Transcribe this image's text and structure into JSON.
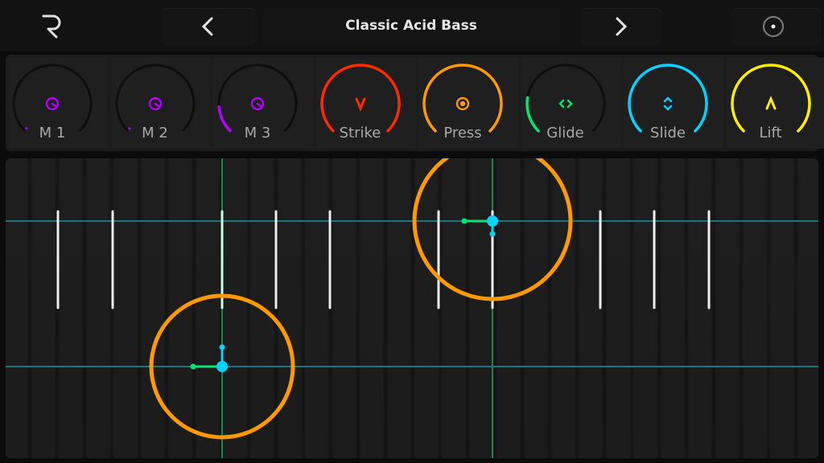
{
  "header": {
    "logo": "R",
    "preset_name": "Classic Acid Bass",
    "prev_icon": "chevron-left-icon",
    "next_icon": "chevron-right-icon",
    "menu_icon": "circle-dot-icon"
  },
  "knobs": [
    {
      "label": "M 1",
      "value": 0,
      "color": "#b400ff",
      "icon": "macro-knob-icon"
    },
    {
      "label": "M 2",
      "value": 0,
      "color": "#b400ff",
      "icon": "macro-knob-icon"
    },
    {
      "label": "M 3",
      "value": 0.15,
      "color": "#b400ff",
      "icon": "macro-knob-icon"
    },
    {
      "label": "Strike",
      "value": 1,
      "color": "#ff2a00",
      "icon": "chevron-down-icon"
    },
    {
      "label": "Press",
      "value": 1,
      "color": "#ff9900",
      "icon": "circle-dot-icon"
    },
    {
      "label": "Glide",
      "value": 0.2,
      "color": "#00e676",
      "icon": "arrows-horizontal-icon"
    },
    {
      "label": "Slide",
      "value": 1,
      "color": "#00d4ff",
      "icon": "arrows-vertical-icon"
    },
    {
      "label": "Lift",
      "value": 1,
      "color": "#ffee00",
      "icon": "chevron-up-icon"
    }
  ],
  "keyboard": {
    "colors": {
      "touch_ring": "#ff9900",
      "glide": "#00e676",
      "slide": "#00d4ff",
      "pitch_line": "#0f8a4a",
      "row_line": "#1d8a99"
    },
    "touches": [
      {
        "key": "upper-row"
      },
      {
        "key": "lower-row"
      }
    ]
  }
}
